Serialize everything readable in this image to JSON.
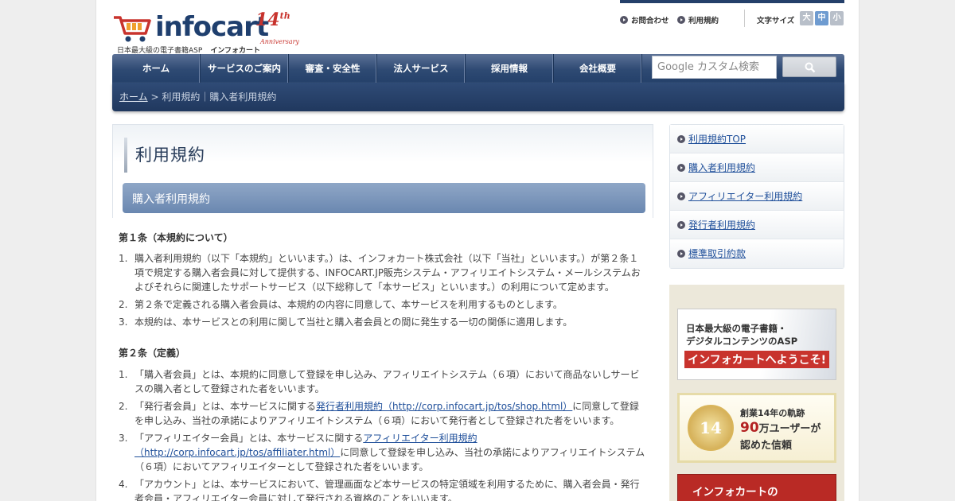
{
  "logo": {
    "word": "infocart",
    "anniv_num": "14",
    "anniv_suffix": "th",
    "anniv_text": "Anniversary",
    "tagline": "日本最大級の電子書籍ASP",
    "tagline_kana": "インフォカート"
  },
  "utility": {
    "contact": "お問合わせ",
    "terms": "利用規約",
    "font_size_label": "文字サイズ",
    "font_sizes": [
      "大",
      "中",
      "小"
    ],
    "active_font_size": "中"
  },
  "nav": {
    "items": [
      "ホーム",
      "サービスのご案内",
      "審査・安全性",
      "法人サービス",
      "採用情報",
      "会社概要"
    ],
    "search_placeholder": "Google カスタム検索"
  },
  "breadcrumb": {
    "home": "ホーム",
    "rest": "> 利用規約｜購入者利用規約"
  },
  "page": {
    "title": "利用規約",
    "subtitle": "購入者利用規約"
  },
  "articles": [
    {
      "heading": "第１条（本規約について）",
      "items": [
        {
          "num": "1.",
          "text": "購入者利用規約（以下「本規約」といいます。）は、インフォカート株式会社（以下「当社」といいます。）が第２条１項で規定する購入者会員に対して提供する、INFOCART.JP販売システム・アフィリエイトシステム・メールシステムおよびそれらに関連したサポートサービス（以下総称して「本サービス」といいます。）の利用について定めます。"
        },
        {
          "num": "2.",
          "text": "第２条で定義される購入者会員は、本規約の内容に同意して、本サービスを利用するものとします。"
        },
        {
          "num": "3.",
          "text": "本規約は、本サービスとの利用に関して当社と購入者会員との間に発生する一切の関係に適用します。"
        }
      ]
    },
    {
      "heading": "第２条（定義）",
      "items": [
        {
          "num": "1.",
          "text": "「購入者会員」とは、本規約に同意して登録を申し込み、アフィリエイトシステム（６項）において商品ないしサービスの購入者として登録された者をいいます。"
        },
        {
          "num": "2.",
          "pre": "「発行者会員」とは、本サービスに関する",
          "link": "発行者利用規約（http://corp.infocart.jp/tos/shop.html）",
          "post": "に同意して登録を申し込み、当社の承諾によりアフィリエイトシステム（６項）において発行者として登録された者をいいます。"
        },
        {
          "num": "3.",
          "pre": "「アフィリエイター会員」とは、本サービスに関する",
          "link": "アフィリエイター利用規約（http://corp.infocart.jp/tos/affiliater.html）",
          "post": "に同意して登録を申し込み、当社の承諾によりアフィリエイトシステム（６項）においてアフィリエイターとして登録された者をいいます。"
        },
        {
          "num": "4.",
          "text": "「アカウント」とは、本サービスにおいて、管理画面など本サービスの特定領域を利用するために、購入者会員・発行者会員・アフィリエイター会員に対して発行される資格のことをいいます。"
        }
      ]
    }
  ],
  "sidebar": {
    "items": [
      "利用規約TOP",
      "購入者利用規約",
      "アフィリエイター利用規約",
      "発行者利用規約",
      "標準取引約款"
    ]
  },
  "banners": {
    "welcome_l1": "日本最大級の電子書籍・",
    "welcome_l2": "デジタルコンテンツのASP",
    "welcome_l3": "インフォカートへようこそ!",
    "medal": "14",
    "history_t1": "創業14年の軌跡",
    "history_num": "90",
    "history_t2": "万ユーザーが",
    "history_t3": "認めた信頼",
    "red_banner": "インフォカートの"
  },
  "colors": {
    "nav": "#2e4a73",
    "link": "#1f4f9a",
    "accent_red": "#c8332d"
  }
}
